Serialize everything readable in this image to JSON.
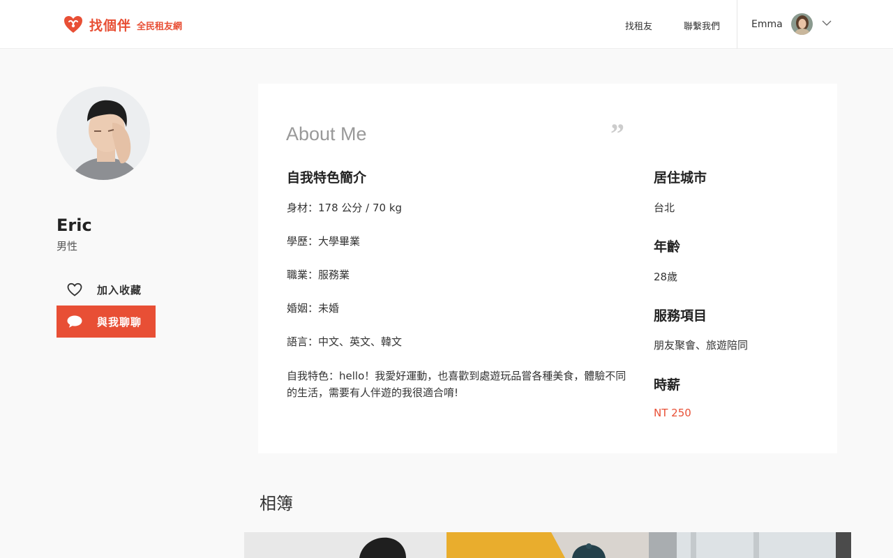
{
  "header": {
    "brand_name": "找個伴",
    "brand_tag": "全民租友網",
    "nav": {
      "find": "找租友",
      "contact": "聯繫我們"
    },
    "user": {
      "name": "Emma"
    }
  },
  "profile": {
    "name": "Eric",
    "gender": "男性",
    "favorite_label": "加入收藏",
    "chat_label": "與我聊聊"
  },
  "about": {
    "title": "About Me",
    "quote": "”",
    "intro_heading": "自我特色簡介",
    "lines": [
      "身材：178 公分 / 70 kg",
      "學歷：大學畢業",
      "職業：服務業",
      "婚姻：未婚",
      "語言：中文、英文、韓文",
      "自我特色：hello！我愛好運動，也喜歡到處遊玩品嘗各種美食，體驗不同的生活，需要有人伴遊的我很適合唷!"
    ],
    "city_heading": "居住城市",
    "city": "台北",
    "age_heading": "年齡",
    "age": "28歲",
    "service_heading": "服務項目",
    "services": "朋友聚會、旅遊陪同",
    "rate_heading": "時薪",
    "rate": "NT 250"
  },
  "album": {
    "title": "相簿"
  },
  "colors": {
    "accent": "#e84f35",
    "background": "#f9f9f9",
    "card": "#ffffff"
  },
  "icons": {
    "brand": "heart-hands-icon",
    "user_caret": "chevron-down-icon",
    "favorite": "heart-outline-icon",
    "chat": "speech-bubble-icon"
  }
}
